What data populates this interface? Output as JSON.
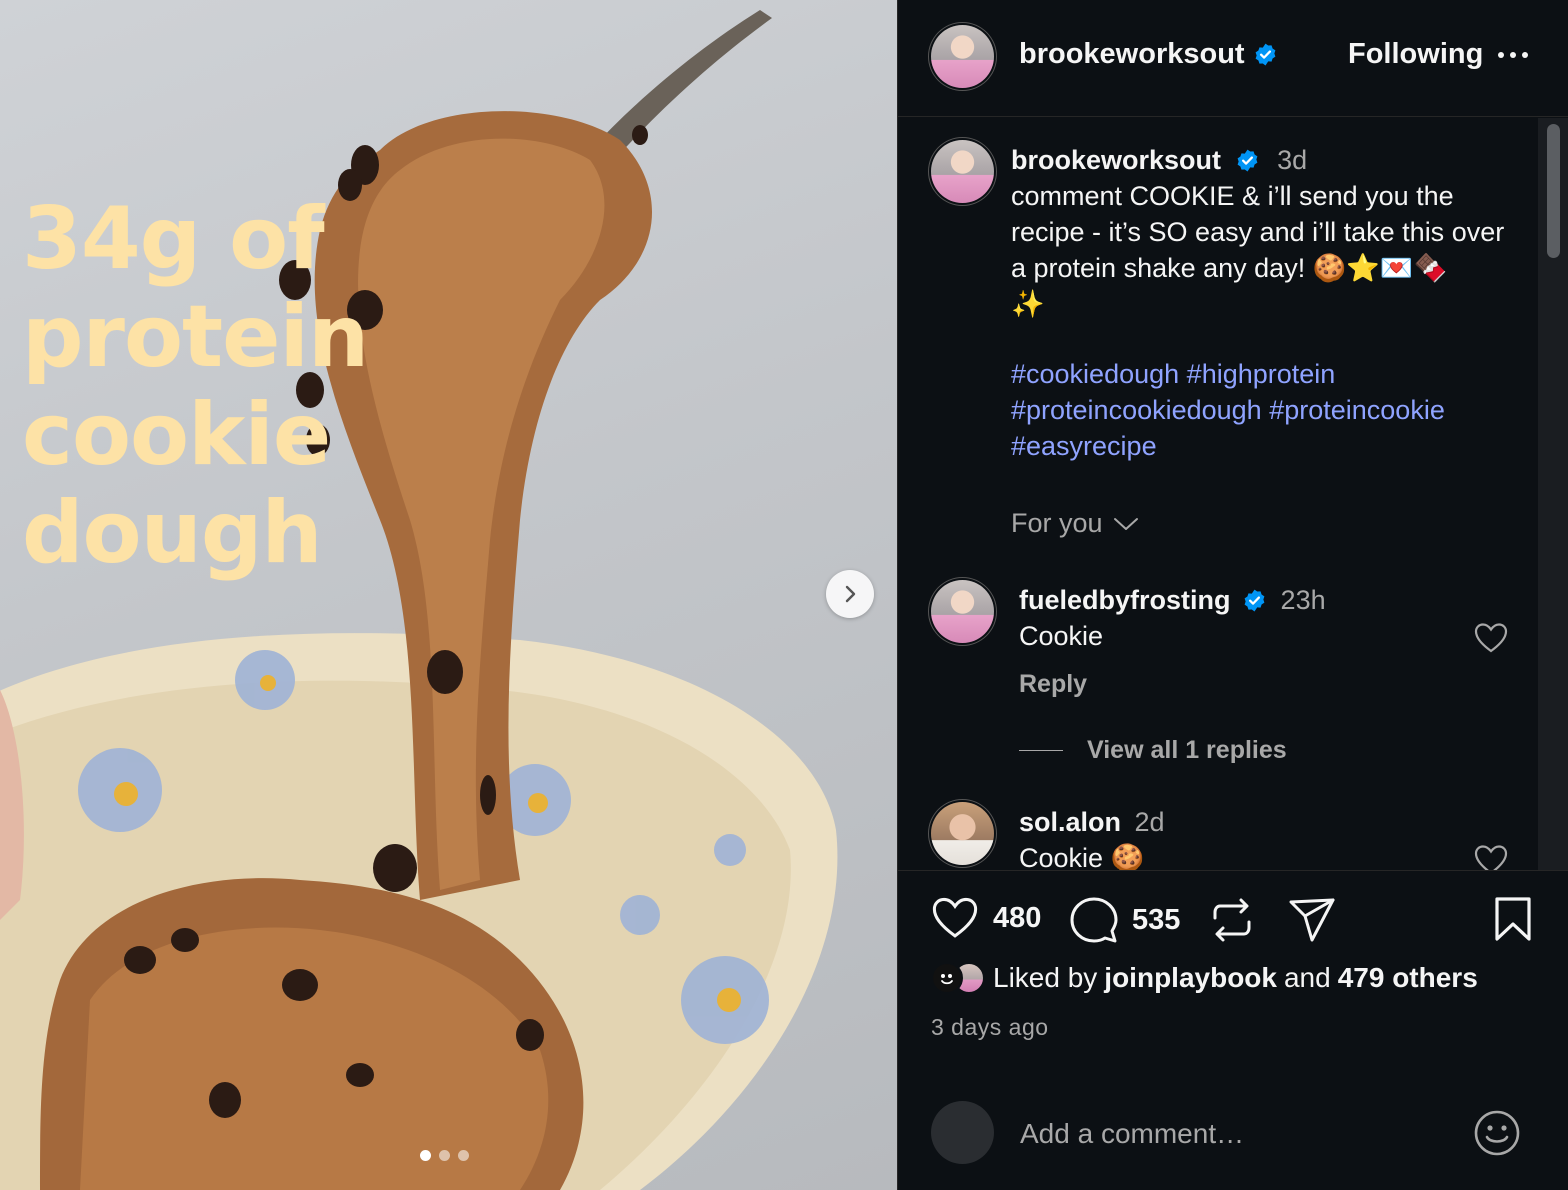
{
  "post": {
    "overlay_lines": [
      "34g of",
      "protein",
      "cookie",
      "dough"
    ],
    "carousel": {
      "count": 3,
      "active": 1
    }
  },
  "header": {
    "username": "brookeworksout",
    "follow_label": "Following"
  },
  "caption": {
    "username": "brookeworksout",
    "time": "3d",
    "text": "comment COOKIE & i’ll send you the recipe - it’s SO easy and i’ll take this over a protein shake any day! 🍪⭐💌🍫",
    "text2": "✨",
    "hashtags": [
      "#cookiedough",
      "#highprotein",
      "#proteincookiedough",
      "#proteincookie",
      "#easyrecipe"
    ]
  },
  "sort": {
    "label": "For you"
  },
  "comments": [
    {
      "username": "fueledbyfrosting",
      "verified": true,
      "time": "23h",
      "text": "Cookie",
      "reply_label": "Reply",
      "view_replies": "View all 1 replies"
    },
    {
      "username": "sol.alon",
      "verified": false,
      "time": "2d",
      "text": "Cookie 🍪"
    }
  ],
  "actions": {
    "likes": "480",
    "comments": "535"
  },
  "liked_by": {
    "prefix": "Liked by",
    "user": "joinplaybook",
    "middle": "and",
    "others": "479 others"
  },
  "posted_ago": "3 days ago",
  "add_comment": {
    "placeholder": "Add a comment…"
  },
  "colors": {
    "background": "#0c1014",
    "hashtag": "#8fa3ff",
    "verified": "#0095f6",
    "overlay_text": "#fde2a6"
  }
}
